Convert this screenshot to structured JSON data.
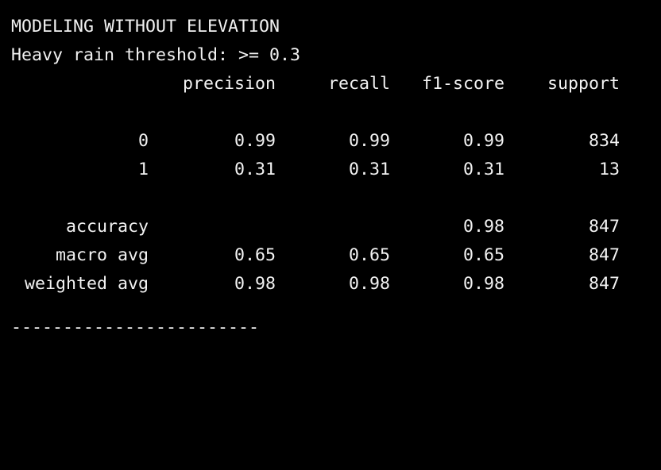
{
  "terminal": {
    "title_line": "MODELING WITHOUT ELEVATION",
    "threshold_line": "Heavy rain threshold: >= 0.3",
    "headers": {
      "precision": "precision",
      "recall": "recall",
      "f1": "f1-score",
      "support": "support"
    },
    "class_rows": [
      {
        "label": "0",
        "precision": "0.99",
        "recall": "0.99",
        "f1": "0.99",
        "support": "834"
      },
      {
        "label": "1",
        "precision": "0.31",
        "recall": "0.31",
        "f1": "0.31",
        "support": "13"
      }
    ],
    "summary_rows": [
      {
        "label": "accuracy",
        "precision": "",
        "recall": "",
        "f1": "0.98",
        "support": "847"
      },
      {
        "label": "macro avg",
        "precision": "0.65",
        "recall": "0.65",
        "f1": "0.65",
        "support": "847"
      },
      {
        "label": "weighted avg",
        "precision": "0.98",
        "recall": "0.98",
        "f1": "0.98",
        "support": "847"
      }
    ],
    "separator": "------------------------",
    "colors": {
      "background": "#000000",
      "text": "#f2f2f2"
    }
  }
}
